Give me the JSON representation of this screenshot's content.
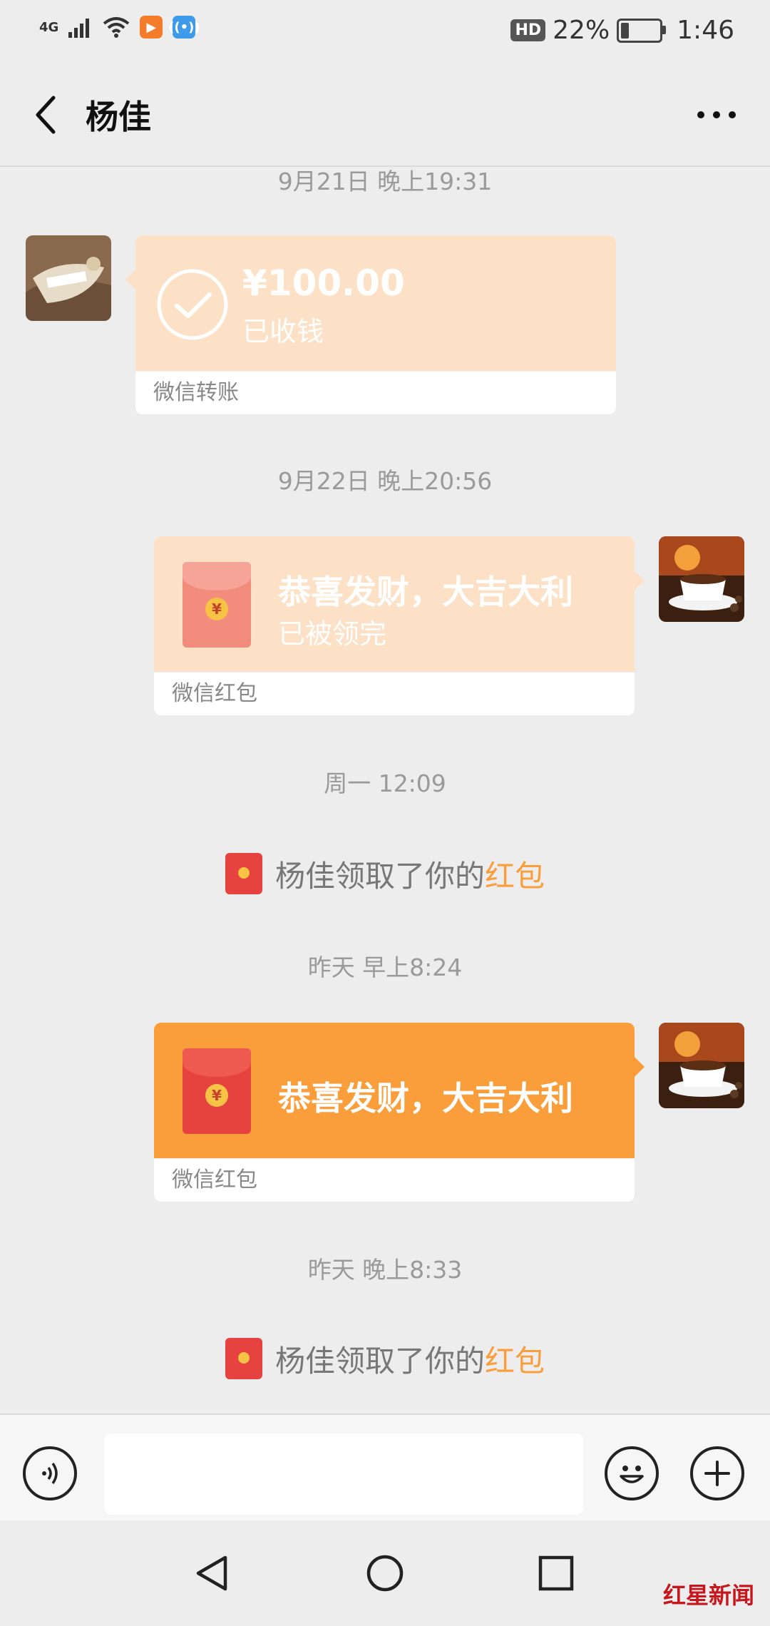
{
  "status_bar": {
    "network": "4G",
    "hd": "HD",
    "battery_percent": "22%",
    "battery_level": 0.22,
    "time": "1:46"
  },
  "header": {
    "title": "杨佳",
    "back_icon": "chevron-left-icon",
    "more_icon": "more-dots-icon"
  },
  "messages": [
    {
      "timestamp": "9月21日 晚上19:31"
    },
    {
      "transfer": {
        "amount": "¥100.00",
        "status": "已收钱",
        "footer": "微信转账"
      }
    },
    {
      "timestamp": "9月22日 晚上20:56"
    },
    {
      "red_packet_1": {
        "title": "恭喜发财，大吉大利",
        "status": "已被领完",
        "footer": "微信红包"
      }
    },
    {
      "timestamp": "周一 12:09"
    },
    {
      "notice_1": {
        "text": "杨佳领取了你的",
        "link": "红包"
      }
    },
    {
      "timestamp": "昨天 早上8:24"
    },
    {
      "red_packet_2": {
        "title": "恭喜发财，大吉大利",
        "footer": "微信红包"
      }
    },
    {
      "timestamp": "昨天 晚上8:33"
    },
    {
      "notice_2": {
        "text": "杨佳领取了你的",
        "link": "红包"
      }
    }
  ],
  "input_bar": {
    "voice_icon": "voice-icon",
    "emoji_icon": "emoji-icon",
    "plus_icon": "plus-icon",
    "placeholder": ""
  },
  "watermark": "红星新闻",
  "colors": {
    "background": "#ededed",
    "pale_card": "#fde1c6",
    "orange_card": "#fa9d3b",
    "red_envelope": "#e64340",
    "link": "#fa9d3b"
  }
}
